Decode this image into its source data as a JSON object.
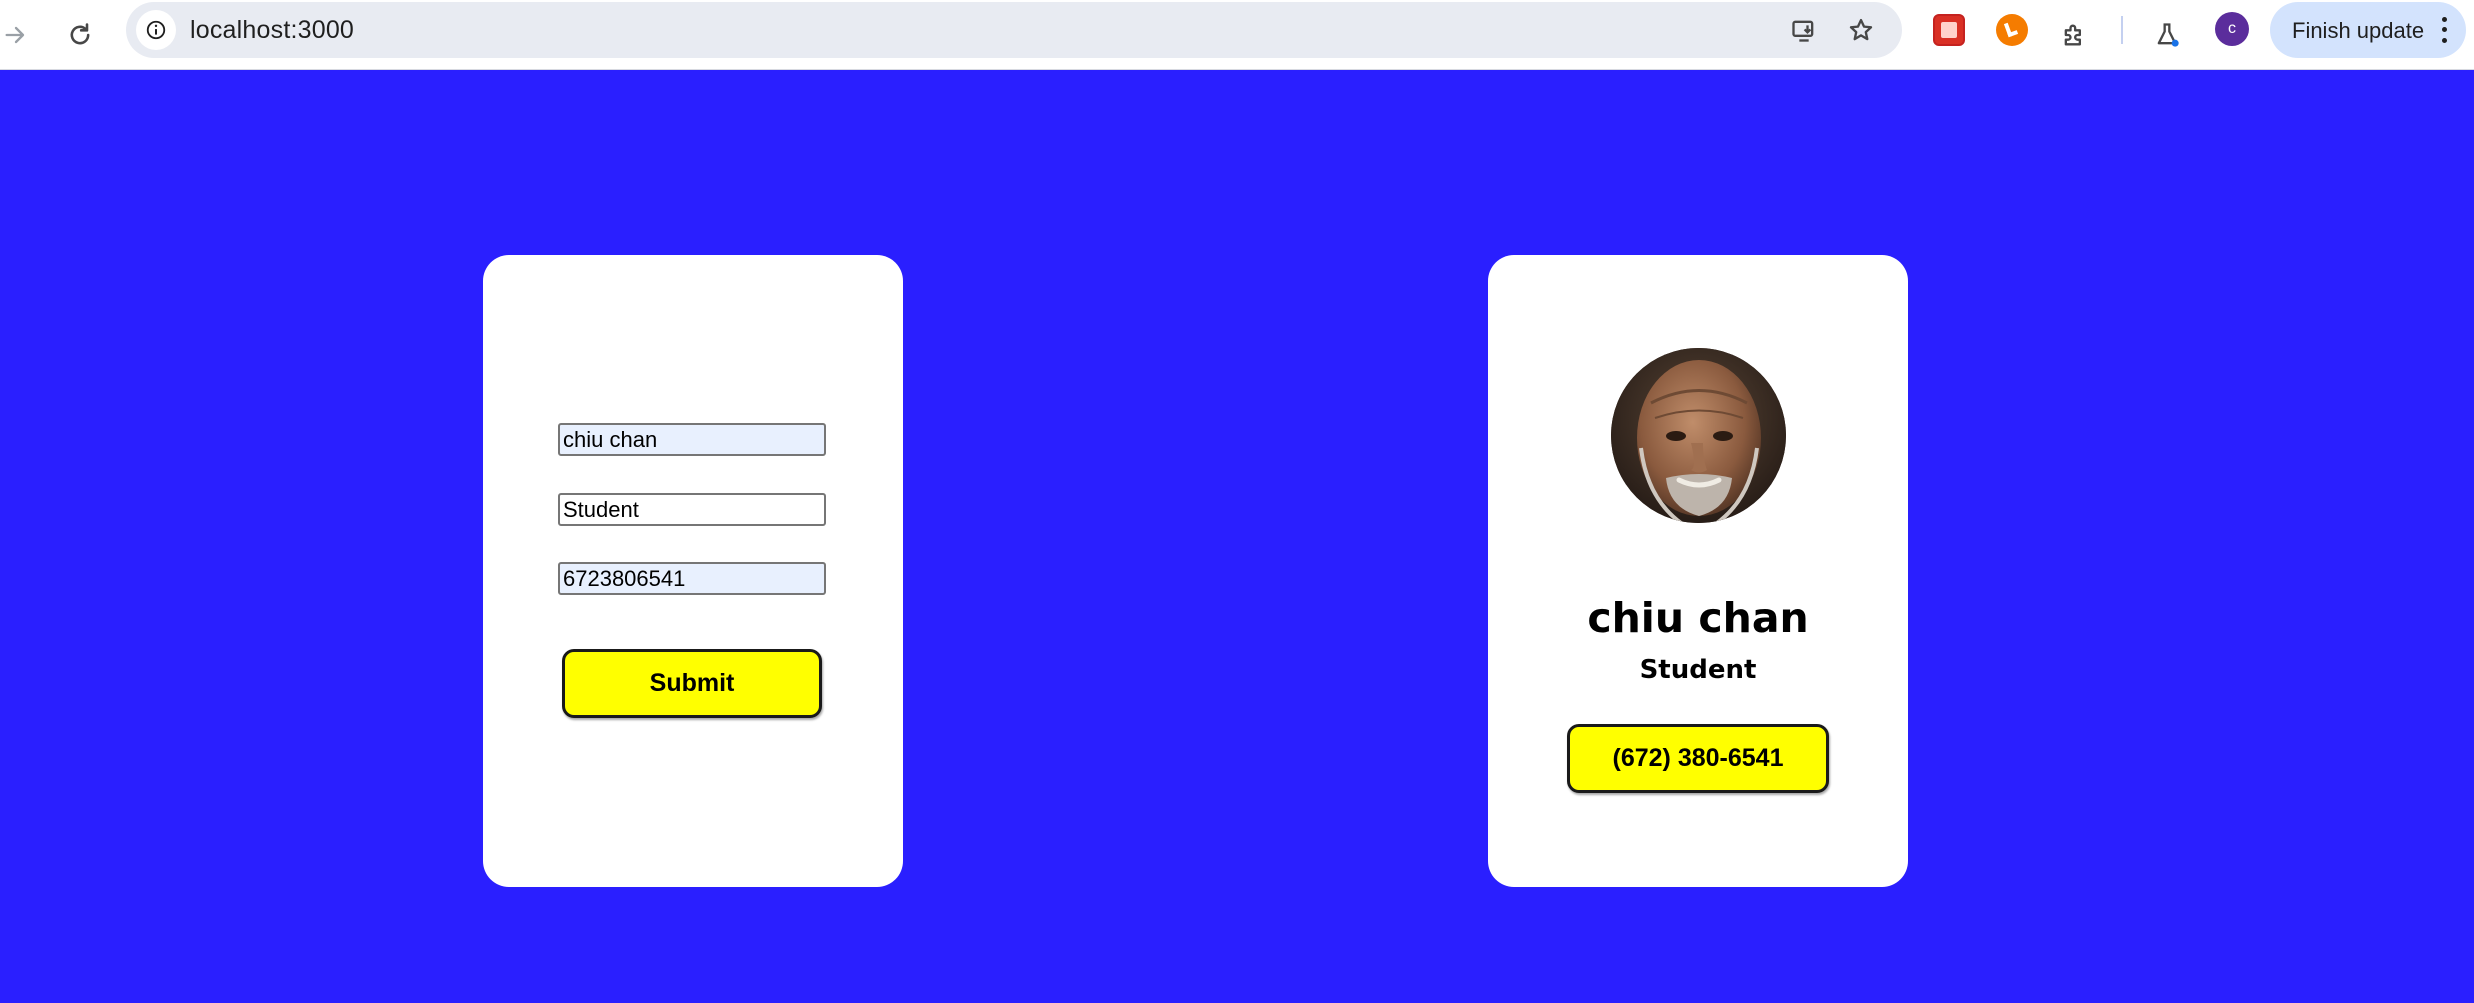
{
  "browser": {
    "url": "localhost:3000",
    "finish_update_label": "Finish update",
    "profile_initial": "c",
    "icons": [
      "forward-icon",
      "reload-icon",
      "site-info-icon",
      "install-app-icon",
      "bookmark-star-icon",
      "extension-puzzle-icon",
      "labs-flask-icon",
      "more-vert-icon"
    ]
  },
  "form": {
    "name_value": "chiu chan",
    "title_value": "Student",
    "phone_value": "6723806541",
    "submit_label": "Submit"
  },
  "profile": {
    "name": "chiu chan",
    "title": "Student",
    "phone": "(672) 380-6541"
  },
  "colors": {
    "page_background": "#2a1fff",
    "card_background": "#ffffff",
    "button_yellow": "#ffff00",
    "autofill_field": "#e8f0fe"
  }
}
